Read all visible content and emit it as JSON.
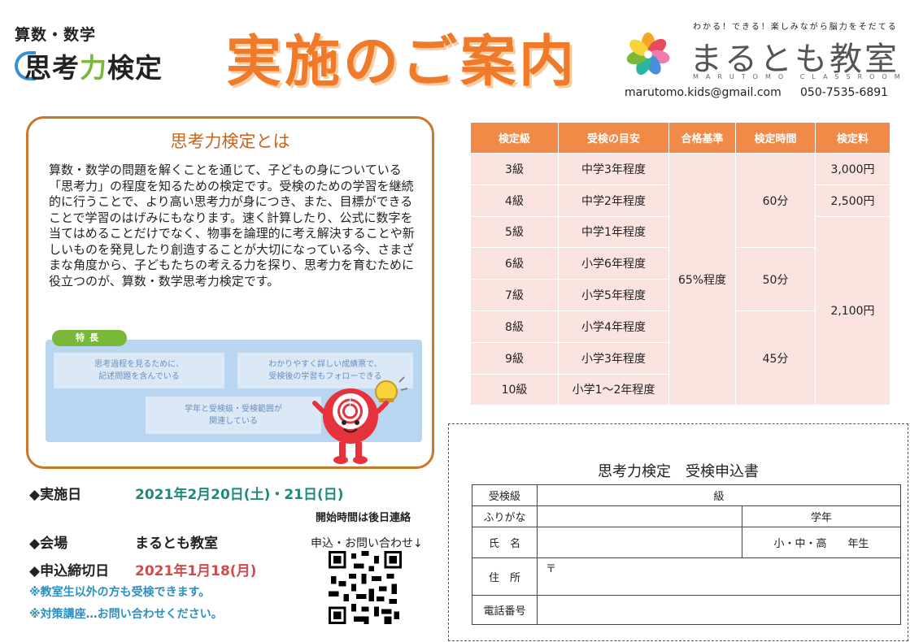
{
  "header": {
    "logo_sub": "算数・数学",
    "logo_main_a": "思",
    "logo_main_b": "考",
    "logo_main_c": "力",
    "logo_main_d": "検定",
    "title": "実施のご案内",
    "brand_tagline": "わかる！できる！楽しみながら脳力をそだてる",
    "brand_name": "まるとも教室",
    "brand_en": "MARUTOMO CLASSROOM",
    "email": "marutomo.kids@gmail.com",
    "tel": "050-7535-6891"
  },
  "about": {
    "heading": "思考力検定とは",
    "body": "算数・数学の問題を解くことを通じて、子どもの身についている「思考力」の程度を知るための検定です。受検のための学習を継続的に行うことで、より高い思考力が身につき、また、目標ができることで学習のはげみにもなります。速く計算したり、公式に数字を当てはめることだけでなく、物事を論理的に考え解決することや新しいものを発見したり創造することが大切になっている今、さまざまな角度から、子どもたちの考える力を探り、思考力を育むために役立つのが、算数・数学思考力検定です。",
    "features_label": "特長",
    "features": [
      "思考過程を見るために、\n記述問題を含んでいる",
      "わかりやすく詳しい成績票で、\n受検後の学習もフォローできる",
      "学年と受検級・受検範囲が\n関連している"
    ]
  },
  "info": {
    "date_label": "◆実施日",
    "date_value": "2021年2月20日(土)・21日(日)",
    "start_note": "開始時間は後日連絡",
    "venue_label": "◆会場",
    "venue_value": "まるとも教室",
    "contact_note": "申込・お問い合わせ↓",
    "deadline_label": "◆申込締切日",
    "deadline_value": "2021年1月18(月)",
    "note1": "※教室生以外の方も受検できます。",
    "note2": "※対策講座…お問い合わせください。"
  },
  "fee_table": {
    "headers": [
      "検定級",
      "受検の目安",
      "合格基準",
      "検定時間",
      "検定料"
    ],
    "grades": [
      "3級",
      "4級",
      "5級",
      "6級",
      "7級",
      "8級",
      "9級",
      "10級"
    ],
    "levels": [
      "中学3年程度",
      "中学2年程度",
      "中学1年程度",
      "小学6年程度",
      "小学5年程度",
      "小学4年程度",
      "小学3年程度",
      "小学1～2年程度"
    ],
    "pass": "65%程度",
    "times": [
      "60分",
      "50分",
      "45分"
    ],
    "fees": [
      "3,000円",
      "2,500円",
      "2,100円"
    ]
  },
  "form": {
    "title": "思考力検定　受検申込書",
    "grade_label": "受検級",
    "grade_suffix": "級",
    "furigana_label": "ふりがな",
    "school_year": "学年",
    "name_label": "氏　名",
    "school_options": "小・中・高　　年生",
    "address_label": "住　所",
    "postal_mark": "〒",
    "phone_label": "電話番号"
  },
  "colors": {
    "orange": "#ee7a2a",
    "teal": "#1f8a7a",
    "red": "#d24a4a",
    "blue_note": "#2a8fbf"
  }
}
